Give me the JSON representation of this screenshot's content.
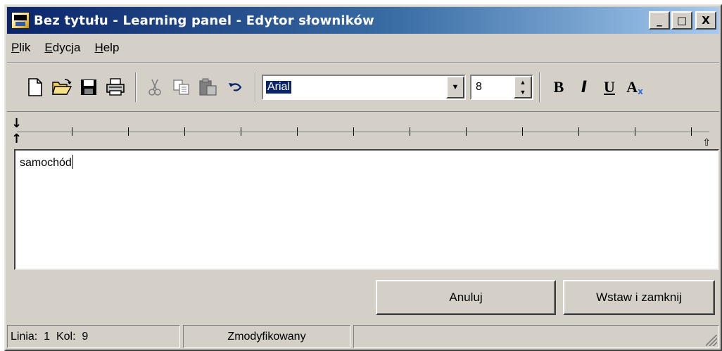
{
  "window": {
    "title": "Bez tytułu - Learning panel - Edytor słowników"
  },
  "title_buttons": {
    "minimize": "_",
    "maximize": "□",
    "close": "X"
  },
  "menu": [
    {
      "mnemonic": "P",
      "rest": "lik"
    },
    {
      "mnemonic": "E",
      "rest": "dycja"
    },
    {
      "mnemonic": "H",
      "rest": "elp"
    }
  ],
  "toolbar": {
    "font_value": "Arial",
    "size_value": "8",
    "bold": "B",
    "italic": "I",
    "underline": "U",
    "font_color": "A"
  },
  "ruler": {
    "top_arrow": "↓",
    "bottom_arrow": "↑",
    "right_marker": "⇧"
  },
  "editor": {
    "text": "samochód"
  },
  "buttons": {
    "cancel": "Anuluj",
    "ok": "Wstaw i zamknij"
  },
  "status": {
    "line_label": "Linia:",
    "line_value": "1",
    "col_label": "Kol:",
    "col_value": "9",
    "state": "Zmodyfikowany"
  },
  "colors": {
    "title_start": "#0a246a",
    "title_end": "#a6caf0",
    "face": "#d4d0c8",
    "selection": "#0a246a"
  }
}
